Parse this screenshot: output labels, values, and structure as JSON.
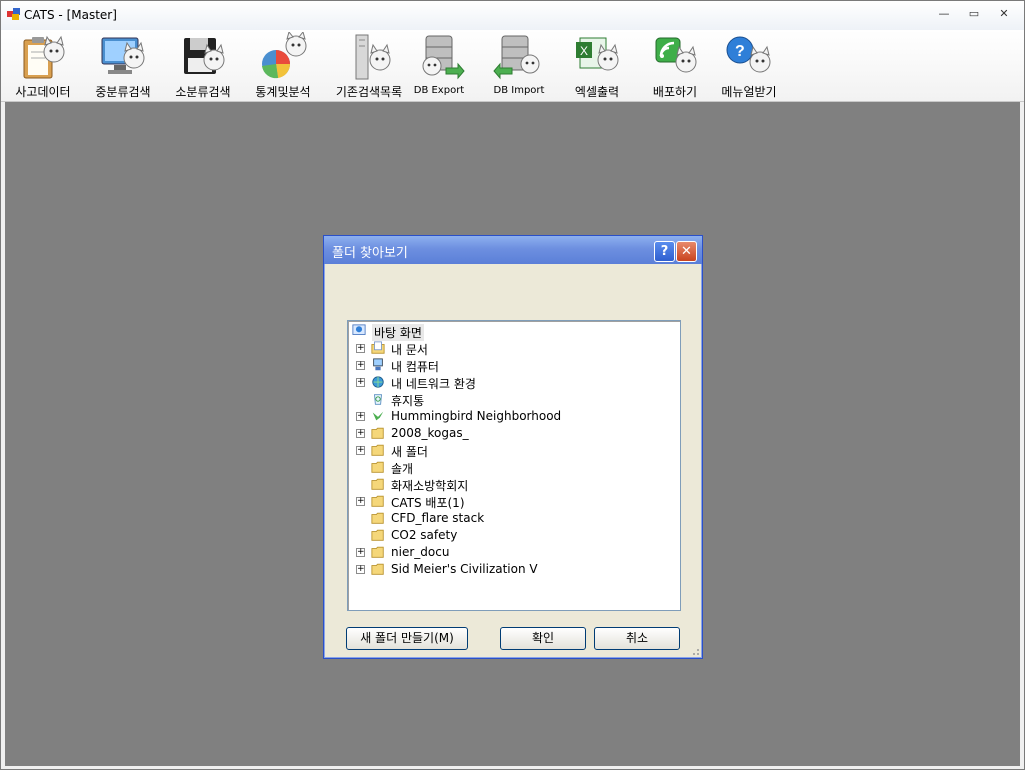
{
  "window": {
    "title": "CATS - [Master]",
    "controls": {
      "minimize": "—",
      "maximize": "▭",
      "close": "✕"
    }
  },
  "toolbar": {
    "items": [
      {
        "label": "사고데이터",
        "icon": "clipboard-cat-icon"
      },
      {
        "label": "중분류검색",
        "icon": "monitor-cat-icon"
      },
      {
        "label": "소분류검색",
        "icon": "floppy-cat-icon"
      },
      {
        "label": "통계및분석",
        "icon": "pie-chart-cat-icon"
      },
      {
        "label": "기존검색목록",
        "icon": "server-cat-icon"
      },
      {
        "label": "DB Export",
        "icon": "db-export-cat-icon"
      },
      {
        "label": "DB Import",
        "icon": "db-import-cat-icon"
      },
      {
        "label": "엑셀출력",
        "icon": "excel-cat-icon"
      },
      {
        "label": "배포하기",
        "icon": "wireless-cat-icon"
      },
      {
        "label": "메뉴얼받기",
        "icon": "help-cat-icon"
      }
    ]
  },
  "dialog": {
    "title": "폴더 찾아보기",
    "help": "?",
    "close": "✕",
    "tree": [
      {
        "label": "바탕 화면",
        "icon": "desktop-icon",
        "expand": false,
        "root": true
      },
      {
        "label": "내 문서",
        "icon": "documents-folder-icon",
        "expand": true
      },
      {
        "label": "내 컴퓨터",
        "icon": "computer-icon",
        "expand": true
      },
      {
        "label": "내 네트워크 환경",
        "icon": "network-icon",
        "expand": true
      },
      {
        "label": "휴지통",
        "icon": "recycle-bin-icon",
        "expand": false
      },
      {
        "label": "Hummingbird Neighborhood",
        "icon": "hummingbird-icon",
        "expand": true
      },
      {
        "label": "2008_kogas_",
        "icon": "folder-icon",
        "expand": true
      },
      {
        "label": "새 폴더",
        "icon": "folder-icon",
        "expand": true
      },
      {
        "label": "솔개",
        "icon": "folder-icon",
        "expand": false
      },
      {
        "label": "화재소방학회지",
        "icon": "folder-icon",
        "expand": false
      },
      {
        "label": "CATS 배포(1)",
        "icon": "folder-icon",
        "expand": true
      },
      {
        "label": "CFD_flare stack",
        "icon": "folder-icon",
        "expand": false
      },
      {
        "label": "CO2 safety",
        "icon": "folder-icon",
        "expand": false
      },
      {
        "label": "nier_docu",
        "icon": "folder-icon",
        "expand": true
      },
      {
        "label": "Sid Meier's Civilization V",
        "icon": "folder-icon",
        "expand": true
      }
    ],
    "buttons": {
      "new_folder": "새 폴더 만들기(M)",
      "ok": "확인",
      "cancel": "취소"
    }
  }
}
